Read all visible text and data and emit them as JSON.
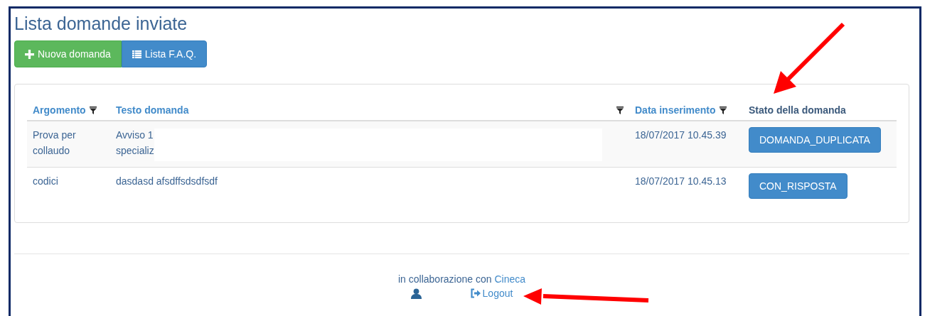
{
  "title": "Lista domande inviate",
  "buttons": [
    {
      "label": "Nuova domanda",
      "kind": "new"
    },
    {
      "label": "Lista F.A.Q.",
      "kind": "list"
    }
  ],
  "table": {
    "columns": [
      {
        "label": "Argomento",
        "link": true,
        "filter": true
      },
      {
        "label": "Testo domanda",
        "link": true,
        "filter": true
      },
      {
        "label": "Data inserimento",
        "link": true,
        "filter": true
      },
      {
        "label": "Stato della domanda",
        "link": false,
        "filter": false
      }
    ],
    "rows": [
      {
        "argomento": "Prova per collaudo",
        "testo": [
          "Avviso 1",
          "specializ"
        ],
        "redacted": true,
        "data": "18/07/2017 10.45.39",
        "stato": "DOMANDA_DUPLICATA"
      },
      {
        "argomento": "codici",
        "testo": [
          "dasdasd afsdffsdsdfsdf"
        ],
        "redacted": false,
        "data": "18/07/2017 10.45.13",
        "stato": "CON_RISPOSTA"
      }
    ]
  },
  "footer": {
    "text": "in collaborazione con",
    "link": "Cineca",
    "logout": "Logout"
  }
}
